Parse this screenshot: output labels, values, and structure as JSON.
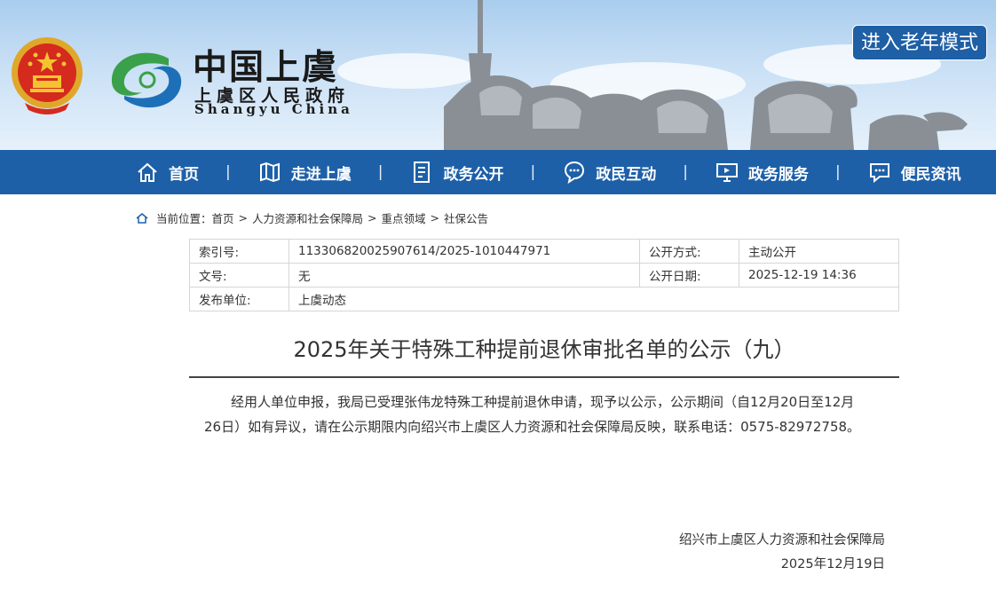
{
  "header": {
    "brand_cn": "中国上虞",
    "brand_sub": "上虞区人民政府",
    "brand_en": "Shangyu China",
    "elder_mode_label": "进入老年模式"
  },
  "nav": {
    "items": [
      {
        "label": "首页",
        "icon": "home-icon"
      },
      {
        "label": "走进上虞",
        "icon": "map-icon"
      },
      {
        "label": "政务公开",
        "icon": "document-icon"
      },
      {
        "label": "政民互动",
        "icon": "chat-icon"
      },
      {
        "label": "政务服务",
        "icon": "monitor-icon"
      },
      {
        "label": "便民资讯",
        "icon": "message-icon"
      }
    ],
    "separator": "|"
  },
  "breadcrumb": {
    "prefix": "当前位置：",
    "items": [
      "首页",
      "人力资源和社会保障局",
      "重点领域",
      "社保公告"
    ],
    "separator": ">"
  },
  "meta": {
    "index_label": "索引号:",
    "index_value": "113306820025907614/2025-1010447971",
    "open_mode_label": "公开方式:",
    "open_mode_value": "主动公开",
    "doc_no_label": "文号:",
    "doc_no_value": "无",
    "open_date_label": "公开日期:",
    "open_date_value": "2025-12-19 14:36",
    "publisher_label": "发布单位:",
    "publisher_value": "上虞动态"
  },
  "article": {
    "title": "2025年关于特殊工种提前退休审批名单的公示（九）",
    "body": "经用人单位申报，我局已受理张伟龙特殊工种提前退休申请，现予以公示，公示期间（自12月20日至12月26日）如有异议，请在公示期限内向绍兴市上虞区人力资源和社会保障局反映，联系电话：0575-82972758。",
    "signature_org": "绍兴市上虞区人力资源和社会保障局",
    "signature_date": "2025年12月19日"
  },
  "colors": {
    "nav_bg": "#1d60a8",
    "elder_btn_bg": "#1e5fa5",
    "logo_green": "#3aa04a",
    "logo_blue": "#1d6fb8"
  }
}
